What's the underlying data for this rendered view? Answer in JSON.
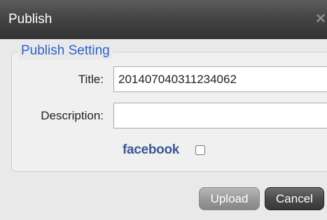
{
  "dialog": {
    "title": "Publish",
    "close_icon": "×"
  },
  "publish_setting": {
    "legend": "Publish Setting",
    "title_label": "Title:",
    "title_value": "20140704031123406​2",
    "description_label": "Description:",
    "description_value": "",
    "facebook_label": "facebook",
    "facebook_checked": false
  },
  "buttons": {
    "upload": "Upload",
    "cancel": "Cancel"
  }
}
